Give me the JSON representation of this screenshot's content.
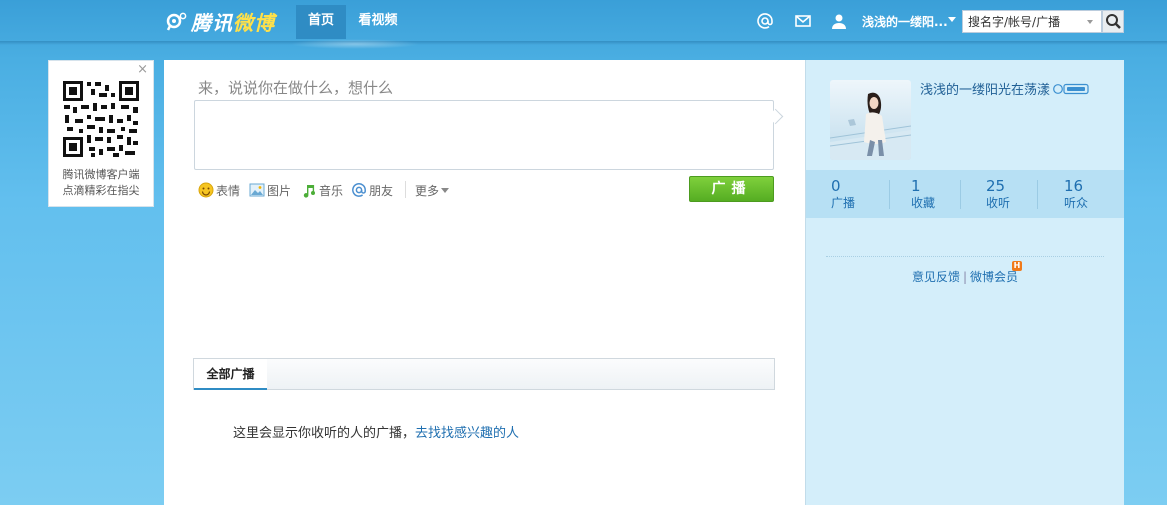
{
  "header": {
    "logo_text_part1": "腾讯",
    "logo_text_part2": "微博",
    "nav": [
      {
        "label": "首页",
        "active": true
      },
      {
        "label": "看视频",
        "active": false
      }
    ],
    "user_name": "浅浅的一缕阳...",
    "search_placeholder": "搜名字/帐号/广播"
  },
  "qr_card": {
    "close": "×",
    "caption_line1": "腾讯微博客户端",
    "caption_line2": "点滴精彩在指尖"
  },
  "composer": {
    "prompt": "来，说说你在做什么，想什么",
    "tools": [
      {
        "label": "表情",
        "icon": "smile-icon"
      },
      {
        "label": "图片",
        "icon": "image-icon"
      },
      {
        "label": "音乐",
        "icon": "music-icon"
      },
      {
        "label": "朋友",
        "icon": "at-icon"
      }
    ],
    "more_label": "更多",
    "submit_label": "广播"
  },
  "feed": {
    "tab_all": "全部广播",
    "empty_text": "这里会显示你收听的人的广播，",
    "empty_link": "去找找感兴趣的人"
  },
  "profile": {
    "name": "浅浅的一缕阳光在荡漾",
    "stats": [
      {
        "value": "0",
        "label": "广播"
      },
      {
        "value": "1",
        "label": "收藏"
      },
      {
        "value": "25",
        "label": "收听"
      },
      {
        "value": "16",
        "label": "听众"
      }
    ],
    "feedback_link": "意见反馈",
    "vip_link": "微博会员",
    "vip_badge": "H"
  },
  "colors": {
    "accent_blue": "#2f8cc4",
    "submit_green": "#62b82a",
    "link_blue": "#1f6fb0"
  }
}
